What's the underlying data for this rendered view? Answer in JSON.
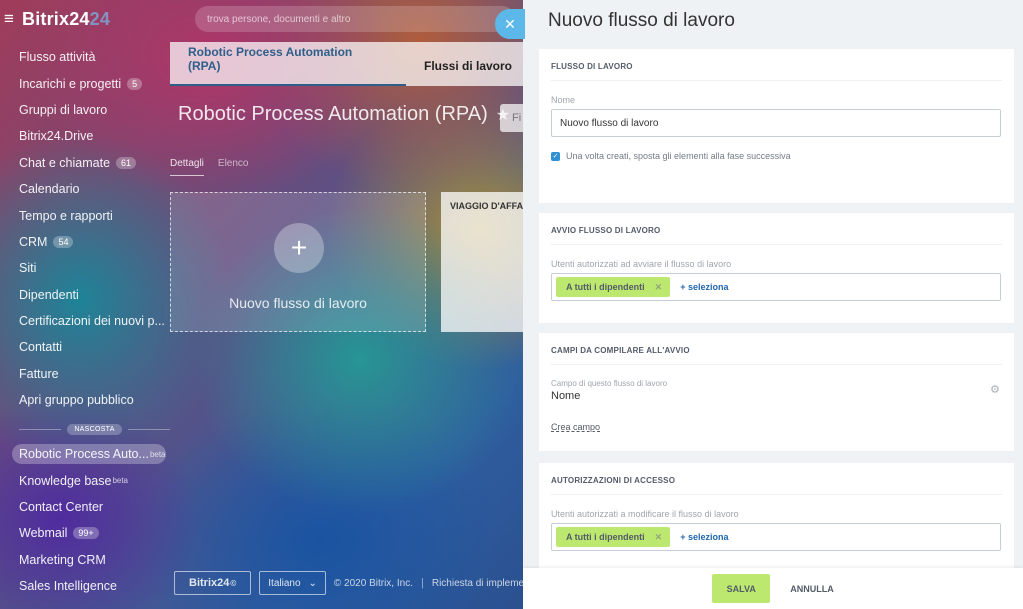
{
  "colors": {
    "accent": "#2f91d4",
    "save_green": "#bde870",
    "link_blue": "#2067b0",
    "close_blue": "#5cb8e8"
  },
  "brand": {
    "name": "Bitrix24",
    "suffix": "24"
  },
  "search": {
    "placeholder": "trova persone, documenti e altro"
  },
  "sidebar": {
    "items": [
      {
        "label": "Flusso attività",
        "badge": ""
      },
      {
        "label": "Incarichi e progetti",
        "badge": "5"
      },
      {
        "label": "Gruppi di lavoro",
        "badge": ""
      },
      {
        "label": "Bitrix24.Drive",
        "badge": ""
      },
      {
        "label": "Chat e chiamate",
        "badge": "61"
      },
      {
        "label": "Calendario",
        "badge": ""
      },
      {
        "label": "Tempo e rapporti",
        "badge": ""
      },
      {
        "label": "CRM",
        "badge": "54"
      },
      {
        "label": "Siti",
        "badge": ""
      },
      {
        "label": "Dipendenti",
        "badge": ""
      },
      {
        "label": "Certificazioni dei nuovi p...",
        "badge": ""
      },
      {
        "label": "Contatti",
        "badge": ""
      },
      {
        "label": "Fatture",
        "badge": ""
      },
      {
        "label": "Apri gruppo pubblico",
        "badge": ""
      }
    ],
    "hidden_label": "NASCOSTA",
    "hidden_items": [
      {
        "label": "Robotic Process Auto...",
        "sup": "beta",
        "badge": ""
      },
      {
        "label": "Knowledge base",
        "sup": "beta",
        "badge": ""
      },
      {
        "label": "Contact Center",
        "sup": "",
        "badge": ""
      },
      {
        "label": "Webmail",
        "sup": "",
        "badge": "99+"
      },
      {
        "label": "Marketing CRM",
        "sup": "",
        "badge": ""
      },
      {
        "label": "Sales Intelligence",
        "sup": "",
        "badge": ""
      }
    ]
  },
  "main": {
    "tabs": [
      "Robotic Process Automation (RPA)",
      "Flussi di lavoro"
    ],
    "title": "Robotic Process Automation (RPA)",
    "filter_placeholder": "Fi",
    "subtabs": [
      "Dettagli",
      "Elenco"
    ],
    "new_card_label": "Nuovo flusso di lavoro",
    "trip_card_label": "VIAGGIO D'AFFARI"
  },
  "footer": {
    "logo": "Bitrix24",
    "logo_mark": "©",
    "language": "Italiano",
    "language_arrow": "⌄",
    "copyright": "© 2020 Bitrix, Inc.",
    "separator": "|",
    "request": "Richiesta di impleme"
  },
  "panel": {
    "title": "Nuovo flusso di lavoro",
    "sections": {
      "workflow": {
        "header": "FLUSSO DI LAVORO",
        "name_label": "Nome",
        "name_value": "Nuovo flusso di lavoro",
        "checkbox_label": "Una volta creati, sposta gli elementi alla fase successiva"
      },
      "start": {
        "header": "AVVIO FLUSSO DI LAVORO",
        "users_label": "Utenti autorizzati ad avviare il flusso di lavoro",
        "chip": "A tutti i dipendenti",
        "select": "+ seleziona"
      },
      "fields": {
        "header": "CAMPI DA COMPILARE ALL'AVVIO",
        "field_sub": "Campo di questo flusso di lavoro",
        "field_value": "Nome",
        "create_link": "Crea campo"
      },
      "access": {
        "header": "AUTORIZZAZIONI DI ACCESSO",
        "users_label": "Utenti autorizzati a modificare il flusso di lavoro",
        "chip": "A tutti i dipendenti",
        "select": "+ seleziona"
      }
    },
    "buttons": {
      "save": "SALVA",
      "cancel": "ANNULLA"
    }
  }
}
